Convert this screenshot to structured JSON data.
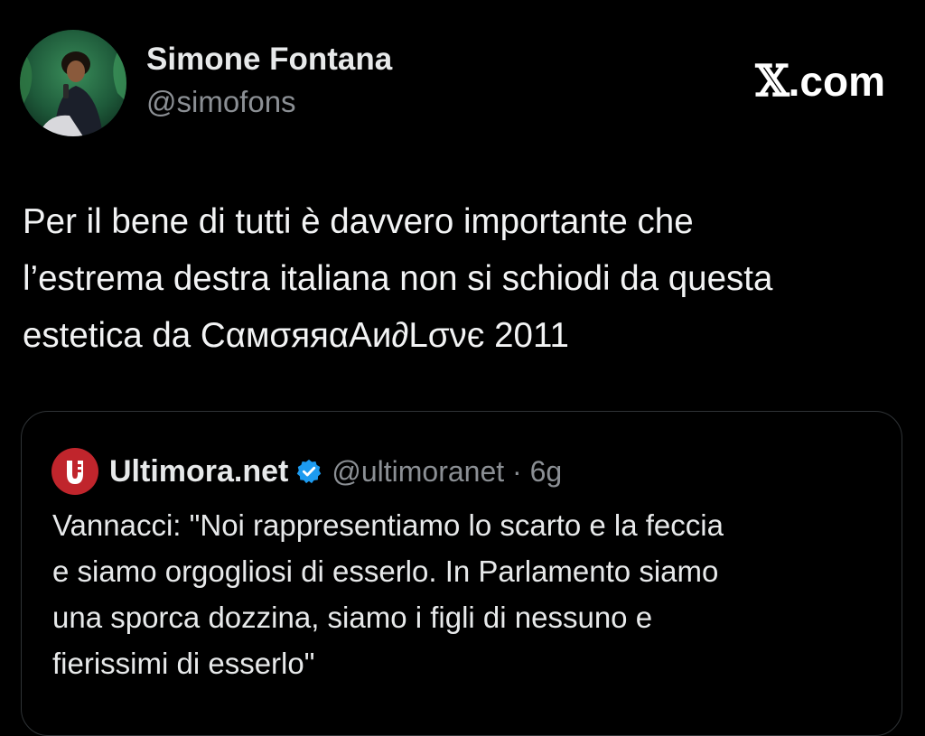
{
  "author": {
    "name": "Simone Fontana",
    "handle": "@simofons",
    "avatar_icon": "profile-photo"
  },
  "brand": {
    "x_glyph": "𝕏",
    "suffix": ".com"
  },
  "tweet": {
    "lines": [
      "Per il bene di tutti è davvero importante che",
      "l’estrema destra italiana non si schiodi da questa",
      "estetica da CαмσяяαAи∂Lσνє 2011"
    ]
  },
  "quoted_tweet": {
    "logo_icon": "ultimora-logo",
    "name": "Ultimora.net",
    "verified": true,
    "meta": "@ultimoranet · 6g",
    "lines": [
      "Vannacci: \"Noi rappresentiamo lo scarto e la feccia",
      "e siamo orgogliosi di esserlo. In Parlamento siamo",
      "una sporca dozzina, siamo i figli di nessuno e",
      "fierissimi di esserlo\""
    ]
  },
  "colors": {
    "background": "#000000",
    "text_primary": "#e7e9ea",
    "text_secondary": "#8b8f94",
    "card_border": "#2f3336",
    "verified_blue": "#1d9bf0",
    "logo_red": "#c0252c"
  }
}
